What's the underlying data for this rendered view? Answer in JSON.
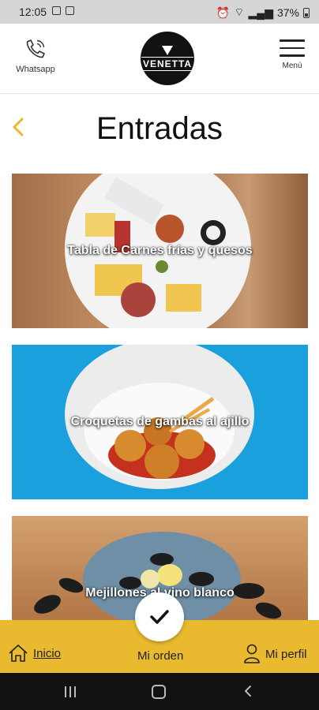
{
  "status_bar": {
    "time": "12:05",
    "battery": "37%"
  },
  "header": {
    "whatsapp_label": "Whatsapp",
    "logo_text": "VENETTA",
    "menu_label": "Menú"
  },
  "page": {
    "title": "Entradas"
  },
  "items": [
    {
      "label": "Tabla de Carnes frías y quesos"
    },
    {
      "label": "Croquetas de gambas al ajillo"
    },
    {
      "label": "Mejillones al vino blanco"
    }
  ],
  "bottom_nav": {
    "home_label": "Inicio",
    "order_label": "Mi orden",
    "profile_label": "Mi perfil"
  },
  "colors": {
    "accent": "#e9b92f",
    "header_bg": "#ffffff",
    "status_bar_bg": "#d6d6d6",
    "system_nav_bg": "#111111"
  }
}
